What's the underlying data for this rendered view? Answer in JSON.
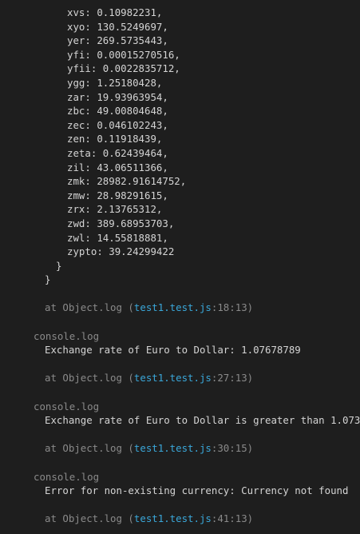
{
  "object_entries": [
    {
      "key": "xvs",
      "value": "0.10982231,"
    },
    {
      "key": "xyo",
      "value": "130.5249697,"
    },
    {
      "key": "yer",
      "value": "269.5735443,"
    },
    {
      "key": "yfi",
      "value": "0.00015270516,"
    },
    {
      "key": "yfii",
      "value": "0.0022835712,"
    },
    {
      "key": "ygg",
      "value": "1.25180428,"
    },
    {
      "key": "zar",
      "value": "19.93963954,"
    },
    {
      "key": "zbc",
      "value": "49.00804648,"
    },
    {
      "key": "zec",
      "value": "0.046102243,"
    },
    {
      "key": "zen",
      "value": "0.11918439,"
    },
    {
      "key": "zeta",
      "value": "0.62439464,"
    },
    {
      "key": "zil",
      "value": "43.06511366,"
    },
    {
      "key": "zmk",
      "value": "28982.91614752,"
    },
    {
      "key": "zmw",
      "value": "28.98291615,"
    },
    {
      "key": "zrx",
      "value": "2.13765312,"
    },
    {
      "key": "zwd",
      "value": "389.68953703,"
    },
    {
      "key": "zwl",
      "value": "14.55818881,"
    },
    {
      "key": "zypto",
      "value": "39.24299422"
    }
  ],
  "inner_close": "}",
  "outer_close": "}",
  "trace1": {
    "prefix": "at Object.log (",
    "file": "test1.test.js",
    "loc": ":18:13",
    "suffix": ")"
  },
  "log1": {
    "header": "console.log",
    "message": "Exchange rate of Euro to Dollar: 1.07678789"
  },
  "trace2": {
    "prefix": "at Object.log (",
    "file": "test1.test.js",
    "loc": ":27:13",
    "suffix": ")"
  },
  "log2": {
    "header": "console.log",
    "message": "Exchange rate of Euro to Dollar is greater than 1.073"
  },
  "trace3": {
    "prefix": "at Object.log (",
    "file": "test1.test.js",
    "loc": ":30:15",
    "suffix": ")"
  },
  "log3": {
    "header": "console.log",
    "message": "Error for non-existing currency: Currency not found"
  },
  "trace4": {
    "prefix": "at Object.log (",
    "file": "test1.test.js",
    "loc": ":41:13",
    "suffix": ")"
  }
}
